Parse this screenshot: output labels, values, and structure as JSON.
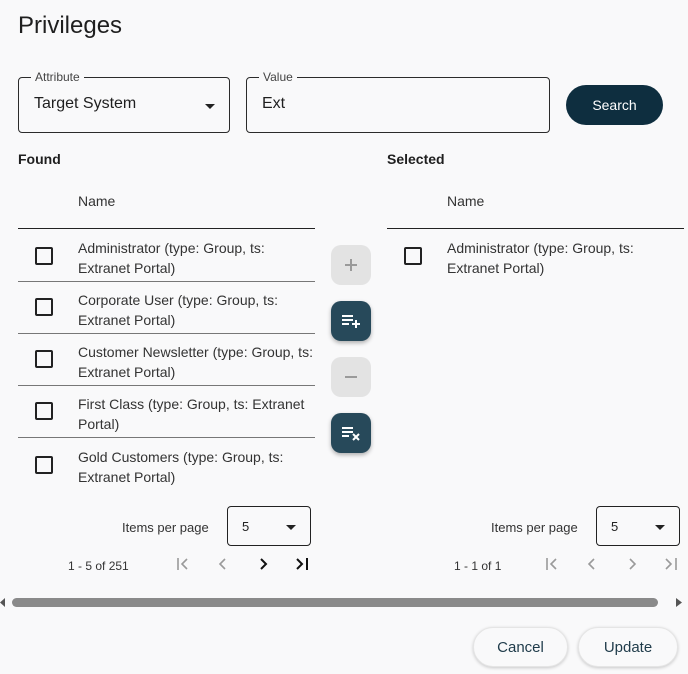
{
  "dialog": {
    "title": "Privileges"
  },
  "search": {
    "attribute_label": "Attribute",
    "attribute_value": "Target System",
    "value_label": "Value",
    "value_input": "Ext",
    "search_button": "Search"
  },
  "found": {
    "heading": "Found",
    "column_name": "Name",
    "rows": [
      "Administrator (type: Group, ts: Extranet Portal)",
      "Corporate User (type: Group, ts: Extranet Portal)",
      "Customer Newsletter (type: Group, ts: Extranet Portal)",
      "First Class (type: Group, ts: Extranet Portal)",
      "Gold Customers (type: Group, ts: Extranet Portal)"
    ],
    "items_per_page_label": "Items per page",
    "items_per_page_value": "5",
    "range": "1 - 5 of 251"
  },
  "selected": {
    "heading": "Selected",
    "column_name": "Name",
    "rows": [
      "Administrator (type: Group, ts: Extranet Portal)"
    ],
    "items_per_page_label": "Items per page",
    "items_per_page_value": "5",
    "range": "1 - 1 of 1"
  },
  "icons": {
    "add": "plus-icon",
    "add_all": "playlist-add-icon",
    "remove": "minus-icon",
    "remove_all": "playlist-remove-icon",
    "first_page": "first-page-icon",
    "prev_page": "chevron-left-icon",
    "next_page": "chevron-right-icon",
    "last_page": "last-page-icon"
  },
  "colors": {
    "primary": "#0e2e3f",
    "transfer_active": "#27495a",
    "transfer_disabled": "#e3e3e3"
  },
  "footer": {
    "cancel": "Cancel",
    "update": "Update"
  }
}
